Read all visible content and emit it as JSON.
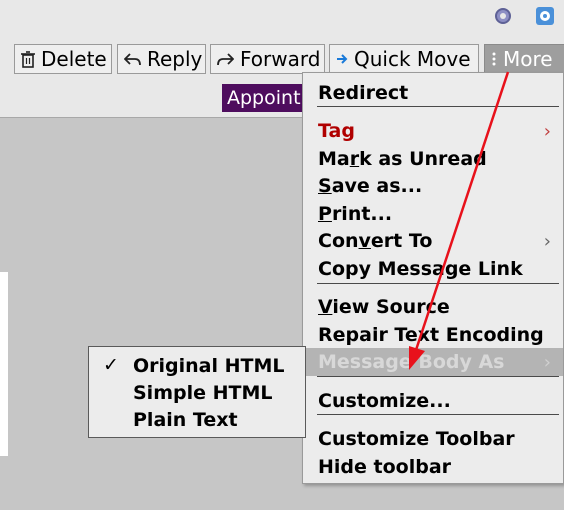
{
  "toolbar": {
    "delete_label": "Delete",
    "reply_label": "Reply",
    "forward_label": "Forward",
    "quick_move_label": "Quick Move",
    "more_label": "More"
  },
  "message": {
    "tag_label": "Appointment"
  },
  "more_menu": {
    "redirect": "Redirect",
    "tag": "Tag",
    "mark_as_unread_pre": "Ma",
    "mark_as_unread_ul": "r",
    "mark_as_unread_post": "k as Unread",
    "save_as_ul": "S",
    "save_as_post": "ave as...",
    "print_ul": "P",
    "print_post": "rint...",
    "convert_to_pre": "Con",
    "convert_to_ul": "v",
    "convert_to_post": "ert To",
    "copy_message_link": "Copy Message Link",
    "view_source_ul": "V",
    "view_source_post": "iew Source",
    "repair_text_encoding": "Repair Text Encoding",
    "message_body_as": "Message Body As",
    "customize": "Customize...",
    "customize_toolbar": "Customize Toolbar",
    "hide_toolbar": "Hide toolbar"
  },
  "body_submenu": {
    "original_html": "Original HTML",
    "simple_html": "Simple HTML",
    "plain_text": "Plain Text"
  },
  "colors": {
    "tag_red": "#b00000",
    "appointment_purple": "#4e0d5e",
    "annotation_arrow": "#e8111b",
    "highlight_gray": "#b4b4b4"
  }
}
